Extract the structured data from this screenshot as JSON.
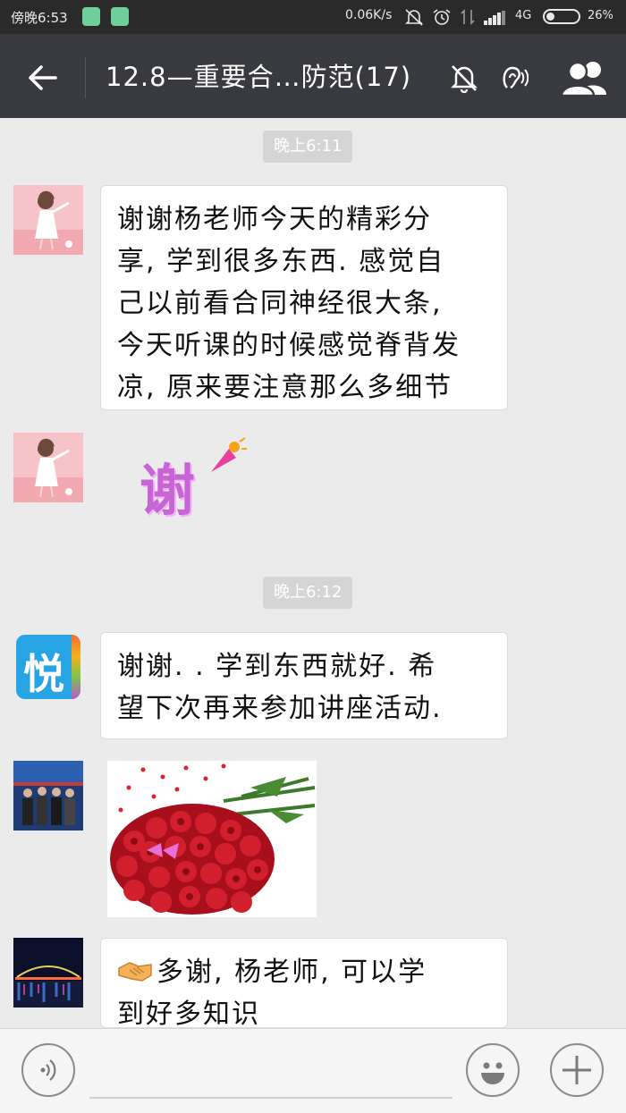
{
  "status_bar": {
    "time": "傍晚6:53",
    "net_speed": "0.06K/s",
    "network": "4G",
    "battery": "26%",
    "battery_level": 0.26
  },
  "header": {
    "title": "12.8—重要合…防范(17)"
  },
  "chat": {
    "timestamp1": "晚上6:11",
    "timestamp2": "晚上6:12",
    "msg1_lines": [
      "谢谢杨老师今天的精彩分",
      "享, 学到很多东西. 感觉自",
      "己以前看合同神经很大条,",
      "今天听课的时候感觉脊背发",
      "凉, 原来要注意那么多细节"
    ],
    "sticker_text": "谢",
    "msg3_lines": [
      "谢谢. . 学到东西就好. 希",
      "望下次再来参加讲座活动."
    ],
    "avatar_logo_text": "悦",
    "msg5_line1": "多谢, 杨老师, 可以学",
    "msg5_line2": "到好多知识"
  },
  "icons": {
    "back": "back-arrow-icon",
    "mute": "mute-bell-icon",
    "earpiece": "earpiece-icon",
    "members": "group-members-icon",
    "voice": "voice-icon",
    "emoji": "emoji-icon",
    "add": "plus-icon"
  }
}
